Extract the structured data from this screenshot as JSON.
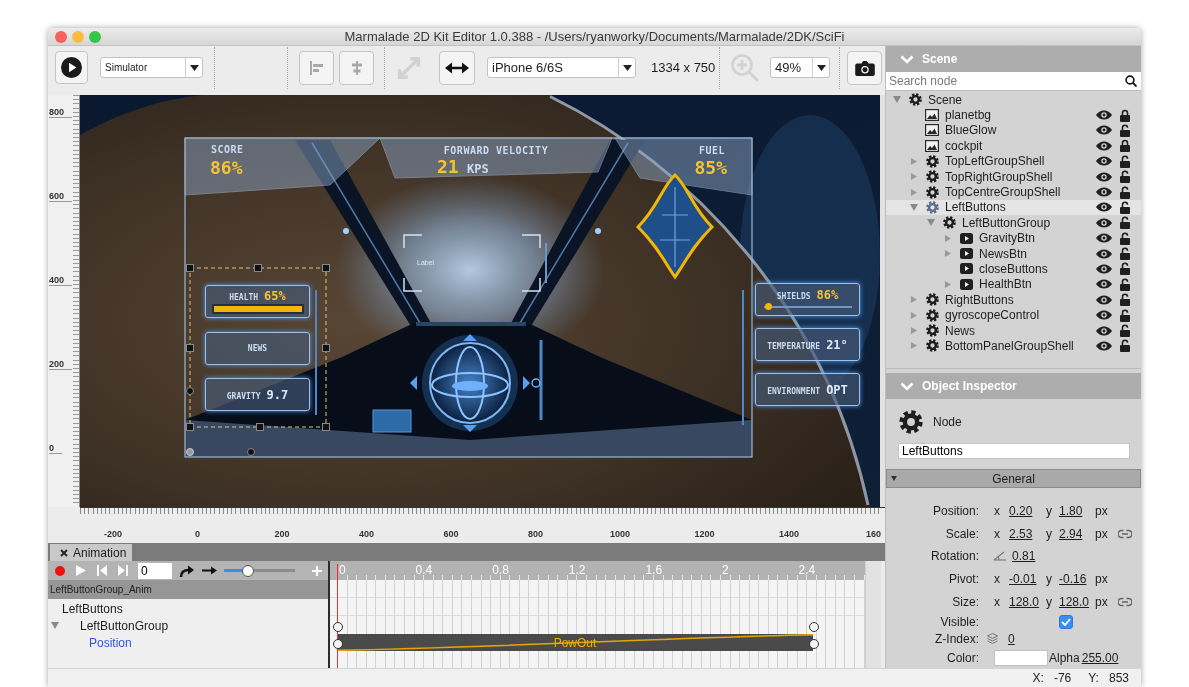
{
  "window": {
    "title": "Marmalade 2D Kit Editor 1.0.388 - /Users/ryanworky/Documents/Marmalade/2DK/SciFi"
  },
  "toolbar": {
    "target": "Simulator",
    "tools": [
      {
        "kind": "align-left",
        "disabled": true
      },
      {
        "kind": "align-center",
        "disabled": true
      },
      {
        "kind": "fit",
        "disabled": true
      },
      {
        "kind": "stretch",
        "disabled": false
      }
    ],
    "device": "iPhone 6/6S",
    "resolution": "1334 x 750",
    "zoom_in": {
      "disabled": true
    },
    "zoom": "49%"
  },
  "rulers": {
    "vertical": [
      "800",
      "600",
      "400",
      "200",
      "0"
    ],
    "horizontal": [
      "-200",
      "0",
      "200",
      "400",
      "600",
      "800",
      "1000",
      "1200",
      "1400",
      "160"
    ]
  },
  "viewport": {
    "score": {
      "label": "SCORE",
      "value": "86%"
    },
    "velocity": {
      "label": "FORWARD VELOCITY",
      "value": "21",
      "unit": "KPS"
    },
    "fuel": {
      "label": "FUEL",
      "value": "85%"
    },
    "reticle_label": "Label",
    "left_panels": [
      {
        "kind": "bar",
        "label": "HEALTH",
        "value": "65%",
        "level": 1
      },
      {
        "kind": "text",
        "label": "NEWS"
      },
      {
        "kind": "value",
        "label": "GRAVITY",
        "value": "9.7"
      }
    ],
    "right_panels": [
      {
        "kind": "slider",
        "label": "SHIELDS",
        "value": "86%",
        "level": 0.02
      },
      {
        "kind": "value",
        "label": "TEMPERATURE",
        "value": "21°"
      },
      {
        "kind": "value",
        "label": "ENVIRONMENT",
        "value": "OPT"
      }
    ]
  },
  "animation": {
    "tab": "Animation",
    "frame_field": "0",
    "slider": {
      "level": 0.3
    },
    "clip": "LeftButtonGroup_Anim",
    "tracks": [
      {
        "label": "LeftButtons",
        "kind": "node",
        "children": [
          {
            "label": "LeftButtonGroup",
            "kind": "node",
            "expanded": true,
            "children": [
              {
                "label": "Position",
                "kind": "property"
              }
            ]
          }
        ]
      }
    ],
    "time_labels": [
      "0",
      "0.4",
      "0.8",
      "1.2",
      "1.6",
      "2",
      "2.4"
    ],
    "easing": "PowOut"
  },
  "scene": {
    "title": "Scene",
    "search_placeholder": "Search node",
    "tree": [
      {
        "label": "Scene",
        "kind": "group",
        "expanded": true,
        "selected": false,
        "children": [
          {
            "label": "planetbg",
            "kind": "image",
            "selected": false,
            "visible": true,
            "locked": true
          },
          {
            "label": "BlueGlow",
            "kind": "image",
            "selected": false,
            "visible": true,
            "locked": false
          },
          {
            "label": "cockpit",
            "kind": "image",
            "selected": false,
            "visible": true,
            "locked": true
          },
          {
            "label": "TopLeftGroupShell",
            "kind": "group",
            "expanded": false,
            "selected": false,
            "visible": true,
            "locked": false
          },
          {
            "label": "TopRightGroupShell",
            "kind": "group",
            "expanded": false,
            "selected": false,
            "visible": true,
            "locked": false
          },
          {
            "label": "TopCentreGroupShell",
            "kind": "group",
            "expanded": false,
            "selected": false,
            "visible": true,
            "locked": false
          },
          {
            "label": "LeftButtons",
            "kind": "group",
            "expanded": true,
            "selected": true,
            "visible": true,
            "locked": false,
            "children": [
              {
                "label": "LeftButtonGroup",
                "kind": "group",
                "expanded": true,
                "selected": false,
                "visible": true,
                "locked": false,
                "children": [
                  {
                    "label": "GravityBtn",
                    "kind": "button",
                    "expanded": false,
                    "selected": false,
                    "visible": true,
                    "locked": false
                  },
                  {
                    "label": "NewsBtn",
                    "kind": "button",
                    "expanded": false,
                    "selected": false,
                    "visible": true,
                    "locked": false
                  },
                  {
                    "label": "closeButtons",
                    "kind": "button",
                    "selected": false,
                    "visible": true,
                    "locked": false
                  },
                  {
                    "label": "HealthBtn",
                    "kind": "button",
                    "expanded": false,
                    "selected": false,
                    "visible": true,
                    "locked": false
                  }
                ]
              }
            ]
          },
          {
            "label": "RightButtons",
            "kind": "group",
            "expanded": false,
            "selected": false,
            "visible": true,
            "locked": false
          },
          {
            "label": "gyroscopeControl",
            "kind": "group",
            "expanded": false,
            "selected": false,
            "visible": true,
            "locked": false
          },
          {
            "label": "News",
            "kind": "group",
            "expanded": false,
            "selected": false,
            "visible": true,
            "locked": false
          },
          {
            "label": "BottomPanelGroupShell",
            "kind": "group",
            "expanded": false,
            "selected": false,
            "visible": true,
            "locked": false
          }
        ]
      }
    ]
  },
  "inspector": {
    "title": "Object Inspector",
    "type": "Node",
    "name": "LeftButtons",
    "section": "General",
    "properties": [
      {
        "kind": "xy",
        "label": "Position:",
        "x": {
          "axis": "x",
          "value": "0.20"
        },
        "y": {
          "axis": "y",
          "value": "1.80"
        },
        "unit": "px",
        "linked": false
      },
      {
        "kind": "xy",
        "label": "Scale:",
        "x": {
          "axis": "x",
          "value": "2.53"
        },
        "y": {
          "axis": "y",
          "value": "2.94"
        },
        "unit": "px",
        "linked": true
      },
      {
        "kind": "angle",
        "label": "Rotation:",
        "value": "0.81"
      },
      {
        "kind": "xy",
        "label": "Pivot:",
        "x": {
          "axis": "x",
          "value": "-0.01"
        },
        "y": {
          "axis": "y",
          "value": "-0.16"
        },
        "unit": "px",
        "linked": false
      },
      {
        "kind": "xy",
        "label": "Size:",
        "x": {
          "axis": "x",
          "value": "128.0"
        },
        "y": {
          "axis": "y",
          "value": "128.0"
        },
        "unit": "px",
        "linked": true
      },
      {
        "kind": "check",
        "label": "Visible:",
        "checked": true
      },
      {
        "kind": "layer",
        "label": "Z-Index:",
        "value": "0"
      },
      {
        "kind": "color",
        "label": "Color:",
        "color": "#ffffff",
        "alpha_label": "Alpha",
        "alpha": "255.00"
      }
    ]
  },
  "status": [
    {
      "label": "X:",
      "value": "-76"
    },
    {
      "label": "Y:",
      "value": "853"
    }
  ]
}
